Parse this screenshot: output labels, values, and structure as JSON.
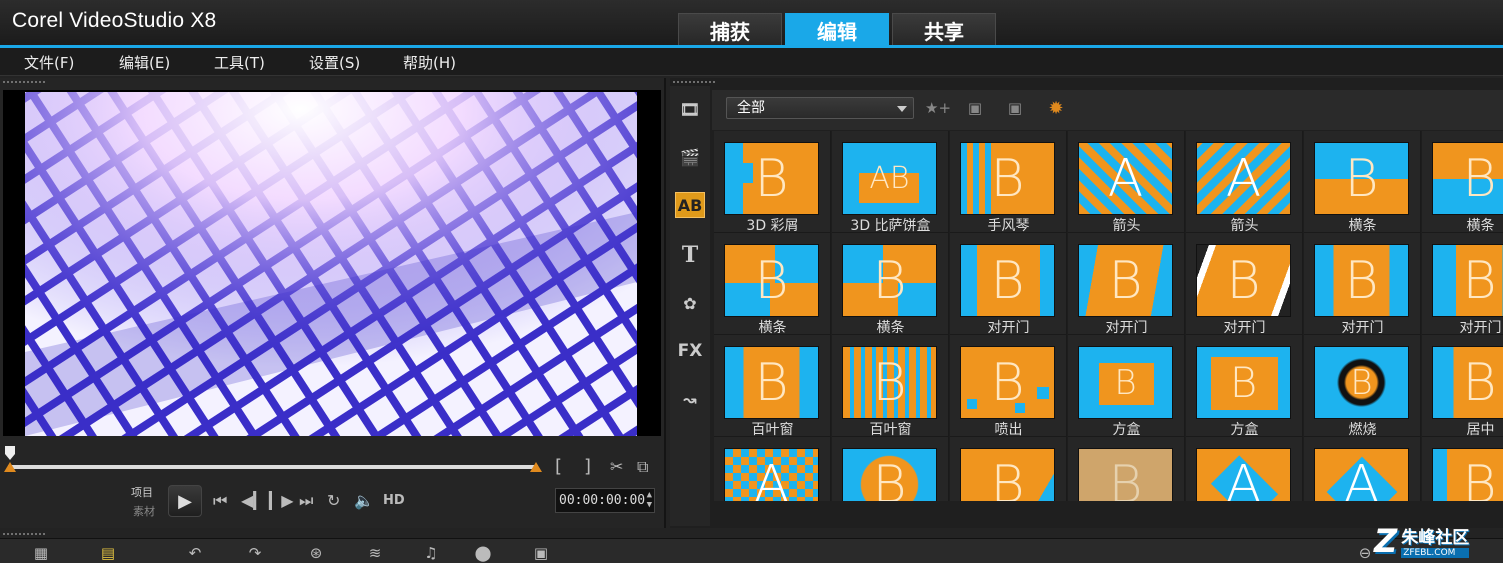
{
  "app": {
    "title": "Corel VideoStudio X8"
  },
  "tabs": [
    {
      "label": "捕获",
      "active": false
    },
    {
      "label": "编辑",
      "active": true
    },
    {
      "label": "共享",
      "active": false
    }
  ],
  "menu": [
    "文件(F)",
    "编辑(E)",
    "工具(T)",
    "设置(S)",
    "帮助(H)"
  ],
  "player": {
    "project_label": "项目",
    "clip_label": "素材",
    "hd_label": "HD",
    "timecode": "00:00:00:00"
  },
  "library": {
    "filter": "全部",
    "items": [
      "3D 彩屑",
      "3D 比萨饼盒",
      "手风琴",
      "箭头",
      "箭头",
      "横条",
      "横条",
      "横条",
      "横条",
      "对开门",
      "对开门",
      "对开门",
      "对开门",
      "对开门",
      "百叶窗",
      "百叶窗",
      "喷出",
      "方盒",
      "方盒",
      "燃烧",
      "居中",
      "",
      "",
      "",
      "",
      "",
      "",
      ""
    ]
  },
  "watermark": {
    "cn": "朱峰社区",
    "url": "ZFEBL.COM"
  },
  "colors": {
    "accent": "#1aa8e8",
    "thumb_orange": "#f0951e",
    "thumb_blue": "#1db3ef"
  }
}
